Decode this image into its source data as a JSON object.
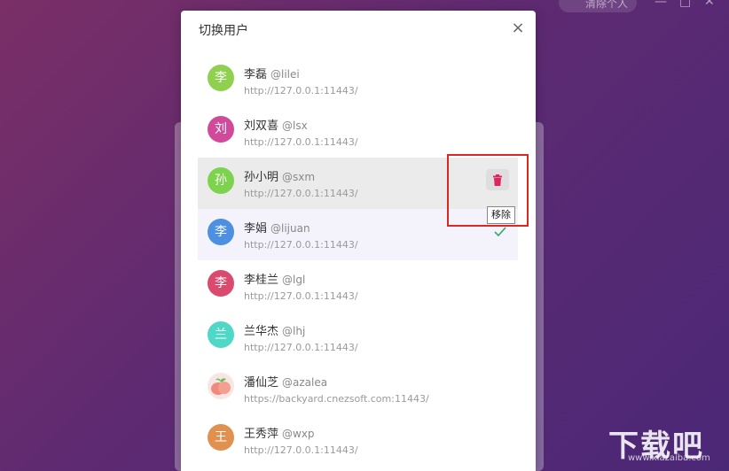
{
  "background": {
    "pill_text": "清除个人",
    "window_controls": [
      "—",
      "□",
      "✕"
    ]
  },
  "dialog": {
    "title": "切换用户",
    "close_label": "×"
  },
  "users": [
    {
      "name": "李磊",
      "handle": "@lilei",
      "url": "http://127.0.0.1:11443/",
      "avatar_char": "李",
      "avatar_color": "#8fd14f",
      "state": "normal"
    },
    {
      "name": "刘双喜",
      "handle": "@lsx",
      "url": "http://127.0.0.1:11443/",
      "avatar_char": "刘",
      "avatar_color": "#d0499a",
      "state": "normal"
    },
    {
      "name": "孙小明",
      "handle": "@sxm",
      "url": "http://127.0.0.1:11443/",
      "avatar_char": "孙",
      "avatar_color": "#7ed34e",
      "state": "hover"
    },
    {
      "name": "李娟",
      "handle": "@lijuan",
      "url": "http://127.0.0.1:11443/",
      "avatar_char": "李",
      "avatar_color": "#4d8fe0",
      "state": "current"
    },
    {
      "name": "李桂兰",
      "handle": "@lgl",
      "url": "http://127.0.0.1:11443/",
      "avatar_char": "李",
      "avatar_color": "#d94a6e",
      "state": "normal"
    },
    {
      "name": "兰华杰",
      "handle": "@lhj",
      "url": "http://127.0.0.1:11443/",
      "avatar_char": "兰",
      "avatar_color": "#4fd8c8",
      "state": "normal"
    },
    {
      "name": "潘仙芝",
      "handle": "@azalea",
      "url": "https://backyard.cnezsoft.com:11443/",
      "avatar_char": "",
      "avatar_color": "#f7e7e4",
      "state": "normal"
    },
    {
      "name": "王秀萍",
      "handle": "@wxp",
      "url": "http://127.0.0.1:11443/",
      "avatar_char": "王",
      "avatar_color": "#e0914f",
      "state": "normal"
    }
  ],
  "tooltip": {
    "remove_label": "移除"
  },
  "colors": {
    "accent_check": "#2eaa6d",
    "delete_icon": "#e0245e",
    "highlight": "#d82a20"
  },
  "watermark": {
    "big": "下载吧",
    "small": "www.xiazaiba.com"
  }
}
